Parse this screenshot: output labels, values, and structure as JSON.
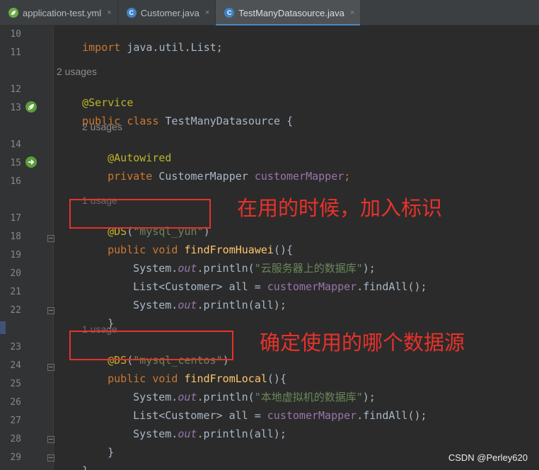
{
  "tabs": [
    {
      "label": "application-test.yml",
      "icon": "spring-yml-icon",
      "active": false
    },
    {
      "label": "Customer.java",
      "icon": "class-icon",
      "active": false
    },
    {
      "label": "TestManyDatasource.java",
      "icon": "class-icon",
      "active": true
    }
  ],
  "tab_close_glyph": "×",
  "class_icon_letter": "C",
  "line_numbers": [
    "10",
    "11",
    "12",
    "13",
    "14",
    "15",
    "16",
    "17",
    "18",
    "19",
    "20",
    "21",
    "22",
    "23",
    "24",
    "25",
    "26",
    "27",
    "28",
    "29"
  ],
  "usages": {
    "class": "2 usages",
    "field": "2 usages",
    "huawei": "1 usage",
    "local": "1 usage"
  },
  "code": {
    "l10": {
      "kw": "import",
      "rest": " java.util.List;"
    },
    "l12": {
      "ann": "@Service"
    },
    "l13": {
      "kw": "public class",
      "rest": " TestManyDatasource {"
    },
    "l14": {
      "ann": "@Autowired"
    },
    "l15": {
      "kw": "private",
      "type": " CustomerMapper ",
      "field": "customerMapper",
      "end": ";"
    },
    "l17": {
      "ann": "@DS",
      "open": "(",
      "str": "\"mysql_yun\"",
      "close": ")"
    },
    "l18": {
      "kw": "public void",
      "sp": " ",
      "fn": "findFromHuawei",
      "end": "(){"
    },
    "l19": {
      "a": "System.",
      "st": "out",
      "b": ".println(",
      "str": "\"云服务器上的数据库\"",
      "end": ");"
    },
    "l20": {
      "a": "List<Customer> all = ",
      "field": "customerMapper",
      "end": ".findAll();"
    },
    "l21": {
      "a": "System.",
      "st": "out",
      "end": ".println(all);"
    },
    "l22": {
      "a": "}"
    },
    "l23": {
      "ann": "@DS",
      "open": "(",
      "str": "\"mysql_centos\"",
      "close": ")"
    },
    "l24": {
      "kw": "public void",
      "sp": " ",
      "fn": "findFromLocal",
      "end": "(){"
    },
    "l25": {
      "a": "System.",
      "st": "out",
      "b": ".println(",
      "str": "\"本地虚拟机的数据库\"",
      "end": ");"
    },
    "l26": {
      "a": "List<Customer> all = ",
      "field": "customerMapper",
      "end": ".findAll();"
    },
    "l27": {
      "a": "System.",
      "st": "out",
      "end": ".println(all);"
    },
    "l28": {
      "a": "}"
    },
    "l29": {
      "a": "}"
    }
  },
  "callouts": {
    "first": "在用的时候，加入标识",
    "second": "确定使用的哪个数据源"
  },
  "watermark": "CSDN @Perley620",
  "colors": {
    "keyword": "#cc7832",
    "annotation": "#bbb529",
    "string": "#6a8759",
    "method": "#ffc66d",
    "field": "#9876aa",
    "text": "#a9b7c6",
    "callout_red": "#e4332b",
    "active_tab_underline": "#4a88c7"
  }
}
